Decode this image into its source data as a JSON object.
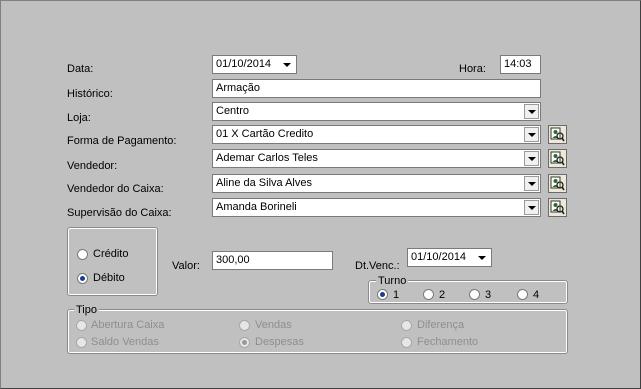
{
  "form": {
    "data_label": "Data:",
    "data_value": "01/10/2014",
    "hora_label": "Hora:",
    "hora_value": "14:03",
    "historico_label": "Histórico:",
    "historico_value": "Armação",
    "loja_label": "Loja:",
    "loja_value": "Centro",
    "forma_label": "Forma de Pagamento:",
    "forma_value": "01 X Cartão Credito",
    "vendedor_label": "Vendedor:",
    "vendedor_value": "Ademar Carlos Teles",
    "vendedor_caixa_label": "Vendedor do Caixa:",
    "vendedor_caixa_value": "Aline da Silva Alves",
    "supervisao_label": "Supervisão do Caixa:",
    "supervisao_value": "Amanda Borineli",
    "valor_label": "Valor:",
    "valor_value": "300,00",
    "dtvenc_label": "Dt.Venc.:",
    "dtvenc_value": "01/10/2014"
  },
  "tipo_mov": {
    "credito_label": "Crédito",
    "debito_label": "Débito",
    "selected": "Débito"
  },
  "turno": {
    "title": "Turno",
    "options": [
      "1",
      "2",
      "3",
      "4"
    ],
    "selected": "1"
  },
  "tipo": {
    "title": "Tipo",
    "options": [
      "Abertura Caixa",
      "Vendas",
      "Diferença",
      "Saldo Vendas",
      "Despesas",
      "Fechamento"
    ],
    "selected": "Despesas",
    "enabled": false
  },
  "icons": {
    "lookup": "search-user-icon"
  },
  "colors": {
    "background": "#c0c0c0",
    "field": "#ffffff",
    "disabled_text": "#8e8e8e",
    "radio_dot": "#1a3f8f"
  }
}
